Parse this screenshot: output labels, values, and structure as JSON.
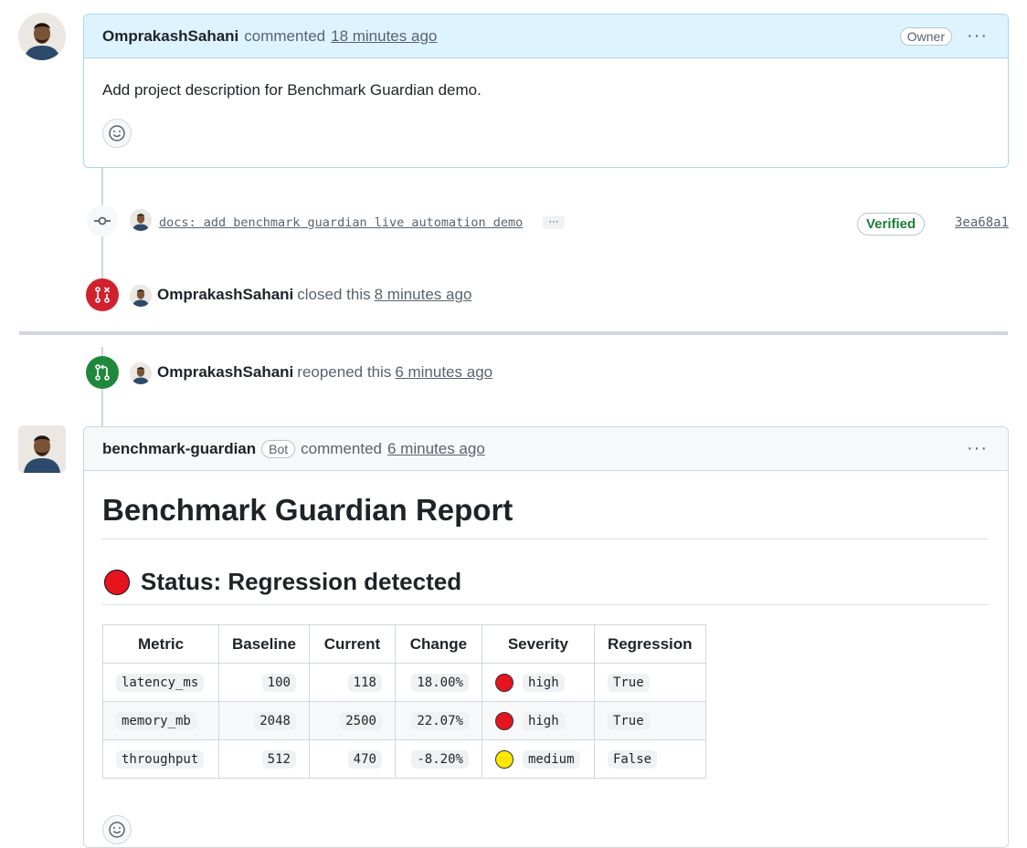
{
  "comment1": {
    "author": "OmprakashSahani",
    "action": "commented",
    "time": "18 minutes ago",
    "badge": "Owner",
    "body": "Add project description for Benchmark Guardian demo.",
    "menu": "···"
  },
  "commit": {
    "message": "docs: add benchmark guardian live automation demo",
    "more": "···",
    "verified": "Verified",
    "sha": "3ea68a1"
  },
  "closed_event": {
    "author": "OmprakashSahani",
    "action": "closed this",
    "time": "8 minutes ago"
  },
  "reopened_event": {
    "author": "OmprakashSahani",
    "action": "reopened this",
    "time": "6 minutes ago"
  },
  "comment2": {
    "author": "benchmark-guardian",
    "badge": "Bot",
    "action": "commented",
    "time": "6 minutes ago",
    "menu": "···",
    "title": "Benchmark Guardian Report",
    "status": "Status: Regression detected",
    "table": {
      "headers": [
        "Metric",
        "Baseline",
        "Current",
        "Change",
        "Severity",
        "Regression"
      ],
      "rows": [
        {
          "metric": "latency_ms",
          "baseline": "100",
          "current": "118",
          "change": "18.00%",
          "severity": "high",
          "regression": "True"
        },
        {
          "metric": "memory_mb",
          "baseline": "2048",
          "current": "2500",
          "change": "22.07%",
          "severity": "high",
          "regression": "True"
        },
        {
          "metric": "throughput",
          "baseline": "512",
          "current": "470",
          "change": "-8.20%",
          "severity": "medium",
          "regression": "False"
        }
      ]
    }
  },
  "colors": {
    "closed": "#cf222e",
    "reopened": "#1f883d",
    "high": "#e5141f",
    "medium": "#ffe600",
    "verified": "#1a7f37"
  }
}
